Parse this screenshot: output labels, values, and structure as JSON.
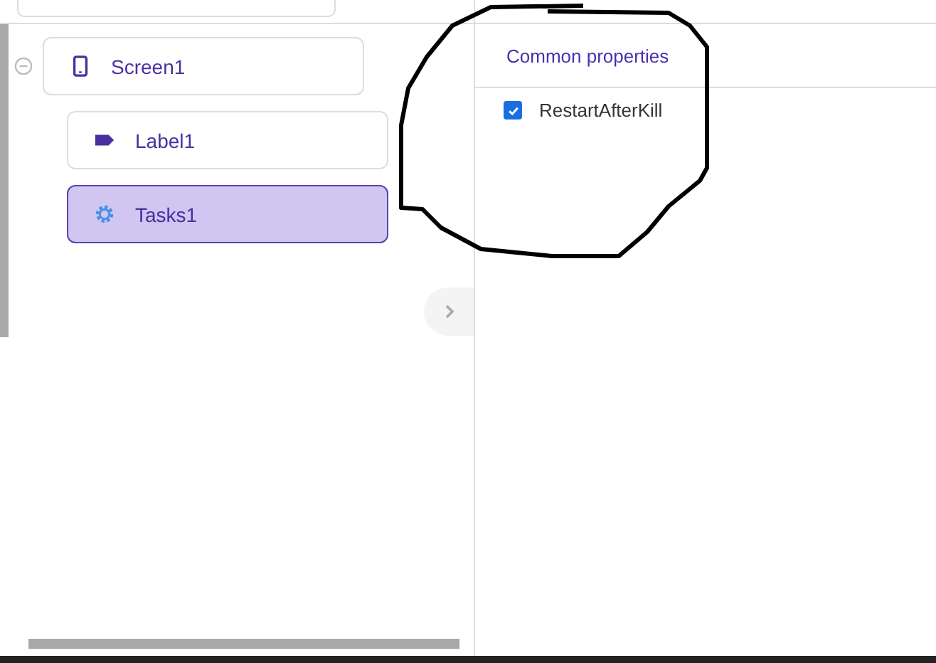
{
  "tree": [
    {
      "name": "Screen1",
      "kind": "screen",
      "expanded": true,
      "selected": false,
      "children": [
        {
          "name": "Label1",
          "kind": "label",
          "selected": false
        },
        {
          "name": "Tasks1",
          "kind": "tasks",
          "selected": true
        }
      ]
    }
  ],
  "properties": {
    "heading": "Common properties",
    "items": [
      {
        "label": "RestartAfterKill",
        "checked": true
      }
    ]
  }
}
